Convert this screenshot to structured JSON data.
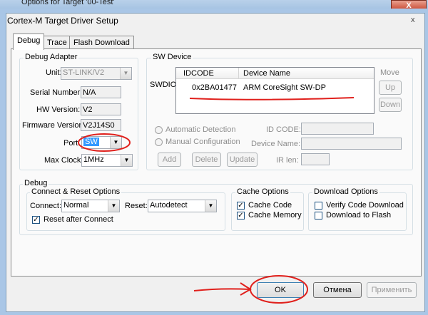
{
  "window": {
    "title": "Options for Target '00-Test'",
    "close": "X"
  },
  "dialog": {
    "title": "Cortex-M Target Driver Setup",
    "close": "x"
  },
  "tabs": [
    {
      "label": "Debug"
    },
    {
      "label": "Trace"
    },
    {
      "label": "Flash Download"
    }
  ],
  "debug_adapter": {
    "title": "Debug Adapter",
    "unit_label": "Unit:",
    "unit_value": "ST-LINK/V2",
    "serial_label": "Serial Number:",
    "serial_value": "N/A",
    "hw_label": "HW Version:",
    "hw_value": "V2",
    "fw_label": "Firmware Version:",
    "fw_value": "V2J14S0",
    "port_label": "Port:",
    "port_value": "SW",
    "clock_label": "Max Clock:",
    "clock_value": "1MHz"
  },
  "sw_device": {
    "title": "SW Device",
    "swdio_label": "SWDIO",
    "col_idcode": "IDCODE",
    "col_device": "Device Name",
    "rows": [
      {
        "idcode": "0x2BA01477",
        "device": "ARM CoreSight SW-DP"
      }
    ],
    "move_label": "Move",
    "up": "Up",
    "down": "Down",
    "auto_detect": "Automatic Detection",
    "manual_config": "Manual Configuration",
    "id_code_label": "ID CODE:",
    "device_name_label": "Device Name:",
    "ir_len_label": "IR len:",
    "add": "Add",
    "delete": "Delete",
    "update": "Update"
  },
  "debug": {
    "title": "Debug",
    "connect_reset": {
      "title": "Connect & Reset Options",
      "connect_label": "Connect:",
      "connect_value": "Normal",
      "reset_label": "Reset:",
      "reset_value": "Autodetect",
      "reset_after_connect": "Reset after Connect",
      "reset_after_connect_checked": true
    },
    "cache": {
      "title": "Cache Options",
      "cache_code": "Cache Code",
      "cache_code_checked": true,
      "cache_memory": "Cache Memory",
      "cache_memory_checked": true
    },
    "download": {
      "title": "Download Options",
      "verify": "Verify Code Download",
      "verify_checked": false,
      "download_flash": "Download to Flash",
      "download_flash_checked": false
    }
  },
  "buttons": {
    "ok": "OK",
    "cancel": "Отмена",
    "apply": "Применить"
  },
  "colors": {
    "annotation": "#e0201c",
    "highlight": "#3399ff"
  }
}
